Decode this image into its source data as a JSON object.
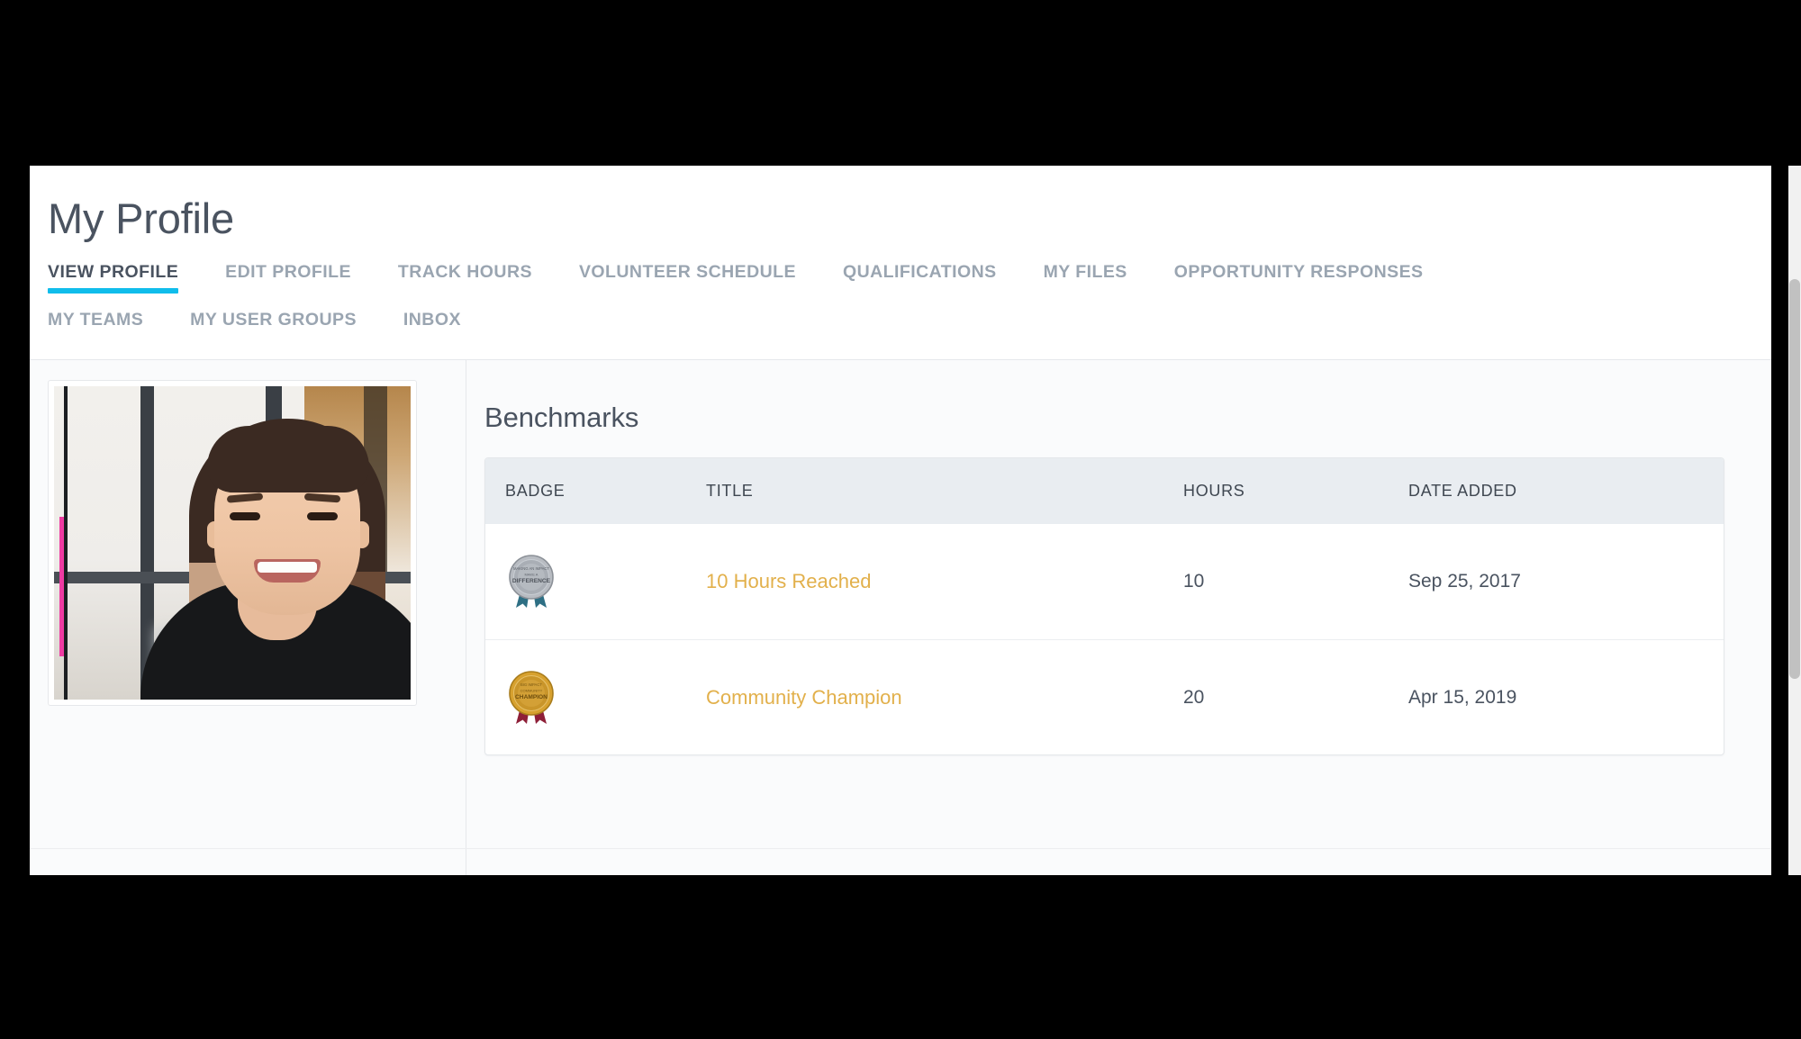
{
  "page": {
    "title": "My Profile"
  },
  "tabs": {
    "row1": [
      {
        "label": "VIEW PROFILE",
        "active": true
      },
      {
        "label": "EDIT PROFILE",
        "active": false
      },
      {
        "label": "TRACK HOURS",
        "active": false
      },
      {
        "label": "VOLUNTEER SCHEDULE",
        "active": false
      },
      {
        "label": "QUALIFICATIONS",
        "active": false
      },
      {
        "label": "MY FILES",
        "active": false
      },
      {
        "label": "OPPORTUNITY RESPONSES",
        "active": false
      }
    ],
    "row2": [
      {
        "label": "MY TEAMS",
        "active": false
      },
      {
        "label": "MY USER GROUPS",
        "active": false
      },
      {
        "label": "INBOX",
        "active": false
      }
    ]
  },
  "profile": {
    "photo_alt": "profile-photo"
  },
  "benchmarks": {
    "heading": "Benchmarks",
    "columns": [
      "BADGE",
      "TITLE",
      "HOURS",
      "DATE ADDED"
    ],
    "rows": [
      {
        "badge_icon": "silver-rosette-medal-icon",
        "badge_text": "MAKE A DIFFERENCE",
        "title": "10 Hours Reached",
        "hours": "10",
        "date_added": "Sep 25, 2017"
      },
      {
        "badge_icon": "gold-rosette-medal-icon",
        "badge_text": "COMMUNITY CHAMPION",
        "title": "Community Champion",
        "hours": "20",
        "date_added": "Apr 15, 2019"
      }
    ]
  },
  "colors": {
    "accent_tab_underline": "#10bdeb",
    "link_gold": "#e2b04b",
    "heading_text": "#4a5360",
    "tab_inactive": "#9aa5b1",
    "table_header_bg": "#e9edf1",
    "panel_bg": "#fafbfc"
  }
}
